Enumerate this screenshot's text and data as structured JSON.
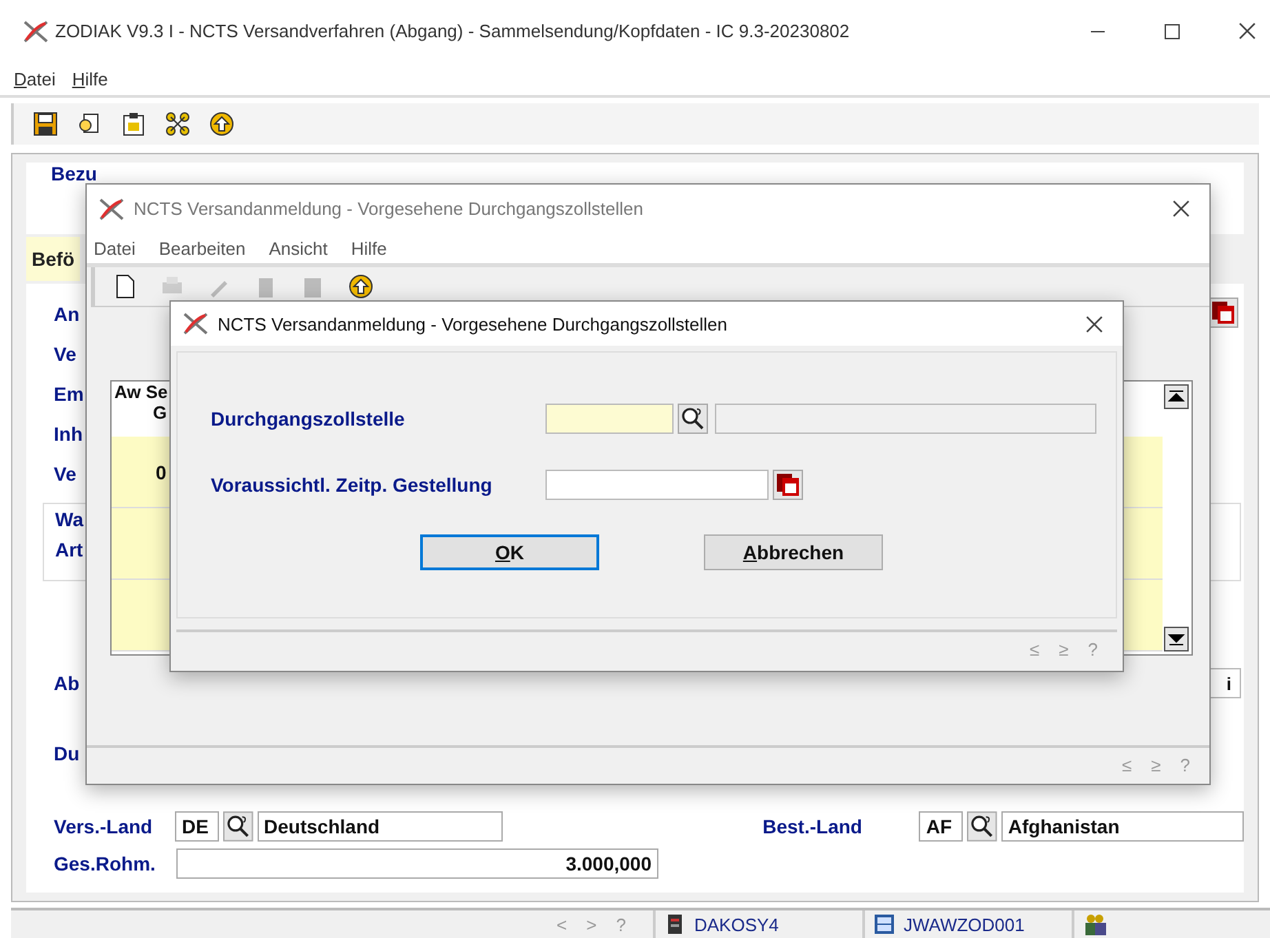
{
  "window": {
    "title": "ZODIAK V9.3 I - NCTS Versandverfahren (Abgang) - Sammelsendung/Kopfdaten - IC 9.3-20230802"
  },
  "menu": [
    {
      "label": "Datei",
      "mnemonic": true
    },
    {
      "label": "Hilfe",
      "mnemonic": true
    }
  ],
  "form": {
    "heading_label": "Bezu",
    "tab": {
      "label": "Befö",
      "selected": true
    },
    "labels": [
      "An",
      "Ve",
      "Em",
      "Inh",
      "Ve"
    ],
    "group_labels": [
      "Wa",
      "Art"
    ],
    "lower_labels": [
      "Ab",
      "Du"
    ],
    "partial_field_value": "i",
    "vers_land": {
      "label": "Vers.-Land",
      "code": "DE",
      "name": "Deutschland"
    },
    "best_land": {
      "label": "Best.-Land",
      "code": "AF",
      "name": "Afghanistan"
    },
    "ges_rohm": {
      "label": "Ges.Rohm.",
      "value": "3.000,000"
    }
  },
  "status_bar": {
    "nav": [
      "<",
      ">",
      "?"
    ],
    "items": [
      {
        "label": "DAKOSY4",
        "kind": "server"
      },
      {
        "label": "JWAWZOD001",
        "kind": "workstation"
      }
    ]
  },
  "list_window": {
    "title": "NCTS Versandanmeldung - Vorgesehene Durchgangszollstellen",
    "menu": [
      "Datei",
      "Bearbeiten",
      "Ansicht",
      "Hilfe"
    ],
    "table": {
      "header": [
        "Aw Se",
        "G"
      ],
      "rows": [
        {
          "cell": "0"
        }
      ]
    },
    "nav": [
      "≤",
      "≥",
      "?"
    ]
  },
  "dialog": {
    "title": "NCTS Versandanmeldung - Vorgesehene Durchgangszollstellen",
    "fields": [
      {
        "label": "Durchgangszollstelle",
        "kind": "lookup",
        "required": true
      },
      {
        "label": "Voraussichtl. Zeitp. Gestellung",
        "kind": "date",
        "required": false
      }
    ],
    "buttons": [
      {
        "label": "OK",
        "mnemonic": true,
        "default": true
      },
      {
        "label": "Abbrechen",
        "mnemonic": true,
        "default": false
      }
    ],
    "nav": [
      "≤",
      "≥",
      "?"
    ]
  }
}
